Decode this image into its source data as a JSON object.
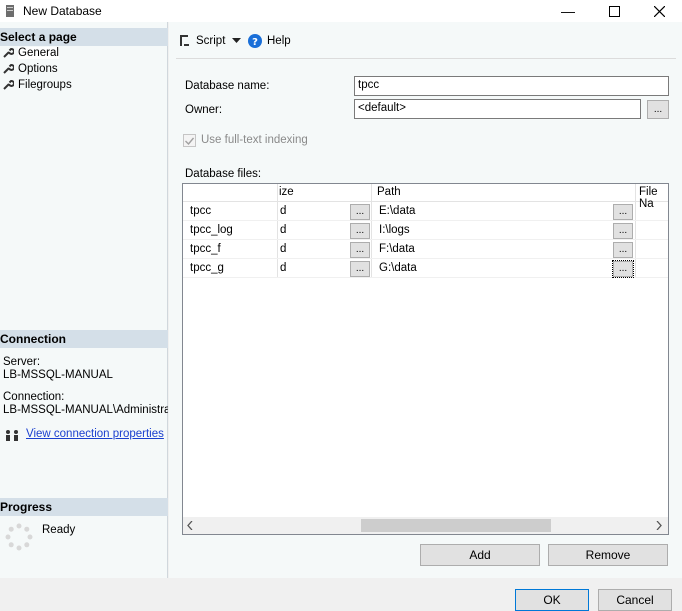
{
  "window": {
    "title": "New Database"
  },
  "left": {
    "select_page_header": "Select a page",
    "pages": [
      "General",
      "Options",
      "Filegroups"
    ],
    "connection_header": "Connection",
    "server_label": "Server:",
    "server_value": "LB-MSSQL-MANUAL",
    "connection_label": "Connection:",
    "connection_value": "LB-MSSQL-MANUAL\\Administrator",
    "view_link": "View connection properties",
    "progress_header": "Progress",
    "progress_status": "Ready"
  },
  "toolbar": {
    "script": "Script",
    "help": "Help"
  },
  "form": {
    "db_name_label": "Database name:",
    "db_name_value": "tpcc",
    "owner_label": "Owner:",
    "owner_value": "<default>",
    "fulltext_label": "Use full-text indexing",
    "db_files_label": "Database files:",
    "browse": "..."
  },
  "grid": {
    "headers": {
      "size": "ize",
      "path": "Path",
      "filename": "File Na"
    },
    "rows": [
      {
        "name": "tpcc",
        "size": "d",
        "path": "E:\\data"
      },
      {
        "name": "tpcc_log",
        "size": "d",
        "path": "I:\\logs"
      },
      {
        "name": "tpcc_f",
        "size": "d",
        "path": "F:\\data"
      },
      {
        "name": "tpcc_g",
        "size": "d",
        "path": "G:\\data"
      }
    ]
  },
  "buttons": {
    "add": "Add",
    "remove": "Remove",
    "ok": "OK",
    "cancel": "Cancel"
  }
}
